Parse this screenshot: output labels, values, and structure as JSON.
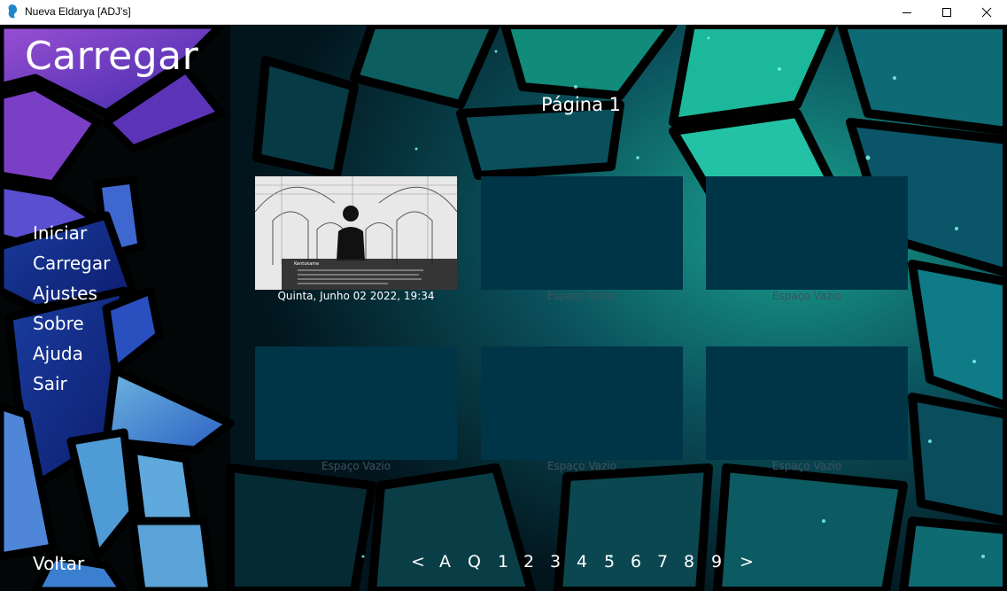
{
  "window": {
    "title": "Nueva Eldarya [ADJ's]",
    "minimize_label": "minimize",
    "maximize_label": "maximize",
    "close_label": "close"
  },
  "screen": {
    "title": "Carregar",
    "page_label": "Página 1"
  },
  "menu": {
    "items": [
      {
        "label": "Iniciar"
      },
      {
        "label": "Carregar"
      },
      {
        "label": "Ajustes"
      },
      {
        "label": "Sobre"
      },
      {
        "label": "Ajuda"
      },
      {
        "label": "Sair"
      }
    ],
    "back": "Voltar"
  },
  "slots": [
    {
      "caption": "Quinta, Junho 02 2022, 19:34",
      "filled": true,
      "thumb_name_label": "Kentukame"
    },
    {
      "caption": "Espaço Vazio",
      "filled": false
    },
    {
      "caption": "Espaço Vazio",
      "filled": false
    },
    {
      "caption": "Espaço Vazio",
      "filled": false
    },
    {
      "caption": "Espaço Vazio",
      "filled": false
    },
    {
      "caption": "Espaço Vazio",
      "filled": false
    }
  ],
  "pager": {
    "prev": "<",
    "auto": "A",
    "quick": "Q",
    "pages": [
      "1",
      "2",
      "3",
      "4",
      "5",
      "6",
      "7",
      "8",
      "9"
    ],
    "next": ">"
  },
  "colors": {
    "slot_empty": "#003447",
    "caption_empty": "#3c5360",
    "text": "#ffffff"
  }
}
